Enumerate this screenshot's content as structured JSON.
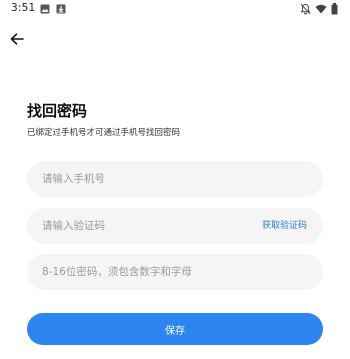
{
  "status_bar": {
    "time": "3:51",
    "left_icons": [
      "image-icon",
      "download-icon"
    ],
    "right_icons": [
      "notifications-off-icon",
      "wifi-icon",
      "battery-icon"
    ]
  },
  "header": {
    "back_icon": "arrow-left-icon"
  },
  "main": {
    "title": "找回密码",
    "subtitle": "已绑定过手机号才可通过手机号找回密码",
    "phone_field": {
      "placeholder": "请输入手机号",
      "value": ""
    },
    "code_field": {
      "placeholder": "请输入验证码",
      "value": "",
      "action_label": "获取验证码"
    },
    "password_field": {
      "placeholder": "8-16位密码，须包含数字和字母",
      "value": ""
    },
    "save_label": "保存"
  },
  "colors": {
    "accent": "#2d86f0",
    "link": "#2a7fe0",
    "field_background": "#f5f5f5",
    "placeholder": "#9a9a9a"
  }
}
